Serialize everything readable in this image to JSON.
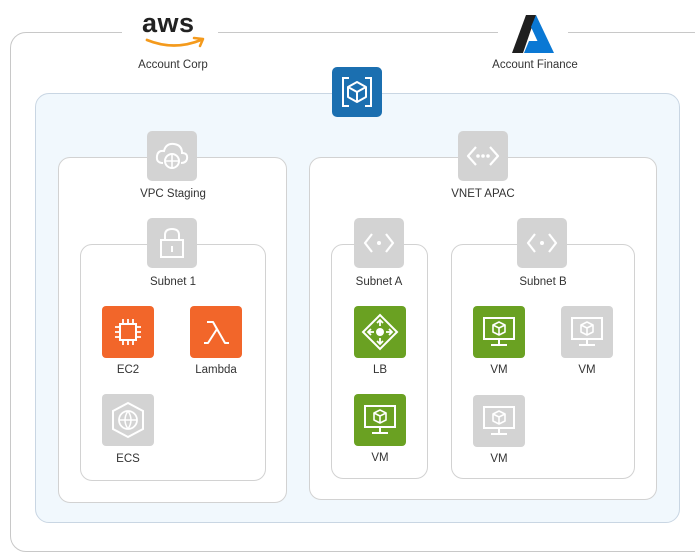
{
  "accounts": {
    "aws": {
      "logo_text": "aws",
      "label": "Account Corp"
    },
    "azure": {
      "label": "Account Finance"
    }
  },
  "groups": {
    "vpc": {
      "label": "VPC Staging",
      "icon": "cloud-network-icon"
    },
    "subnet1": {
      "label": "Subnet 1",
      "icon": "lock-icon"
    },
    "vnet": {
      "label": "VNET APAC",
      "icon": "vnet-icon"
    },
    "subnetA": {
      "label": "Subnet A",
      "icon": "vnet-icon"
    },
    "subnetB": {
      "label": "Subnet B",
      "icon": "vnet-icon"
    }
  },
  "nodes": {
    "ec2": {
      "label": "EC2",
      "icon": "chip-icon"
    },
    "lambda": {
      "label": "Lambda",
      "icon": "lambda-icon"
    },
    "ecs": {
      "label": "ECS",
      "icon": "container-service-icon"
    },
    "lb": {
      "label": "LB",
      "icon": "load-balancer-icon"
    },
    "vm_a": {
      "label": "VM",
      "icon": "virtual-machine-icon"
    },
    "vm_b1": {
      "label": "VM",
      "icon": "virtual-machine-icon"
    },
    "vm_b2": {
      "label": "VM",
      "icon": "virtual-machine-icon"
    },
    "vm_b3": {
      "label": "VM",
      "icon": "virtual-machine-icon"
    }
  },
  "colors": {
    "aws_orange": "#f2662a",
    "green": "#6aa122",
    "grey": "#d3d3d3",
    "blue_badge": "#1b6fb0",
    "azure_blue": "#0a78d4"
  }
}
